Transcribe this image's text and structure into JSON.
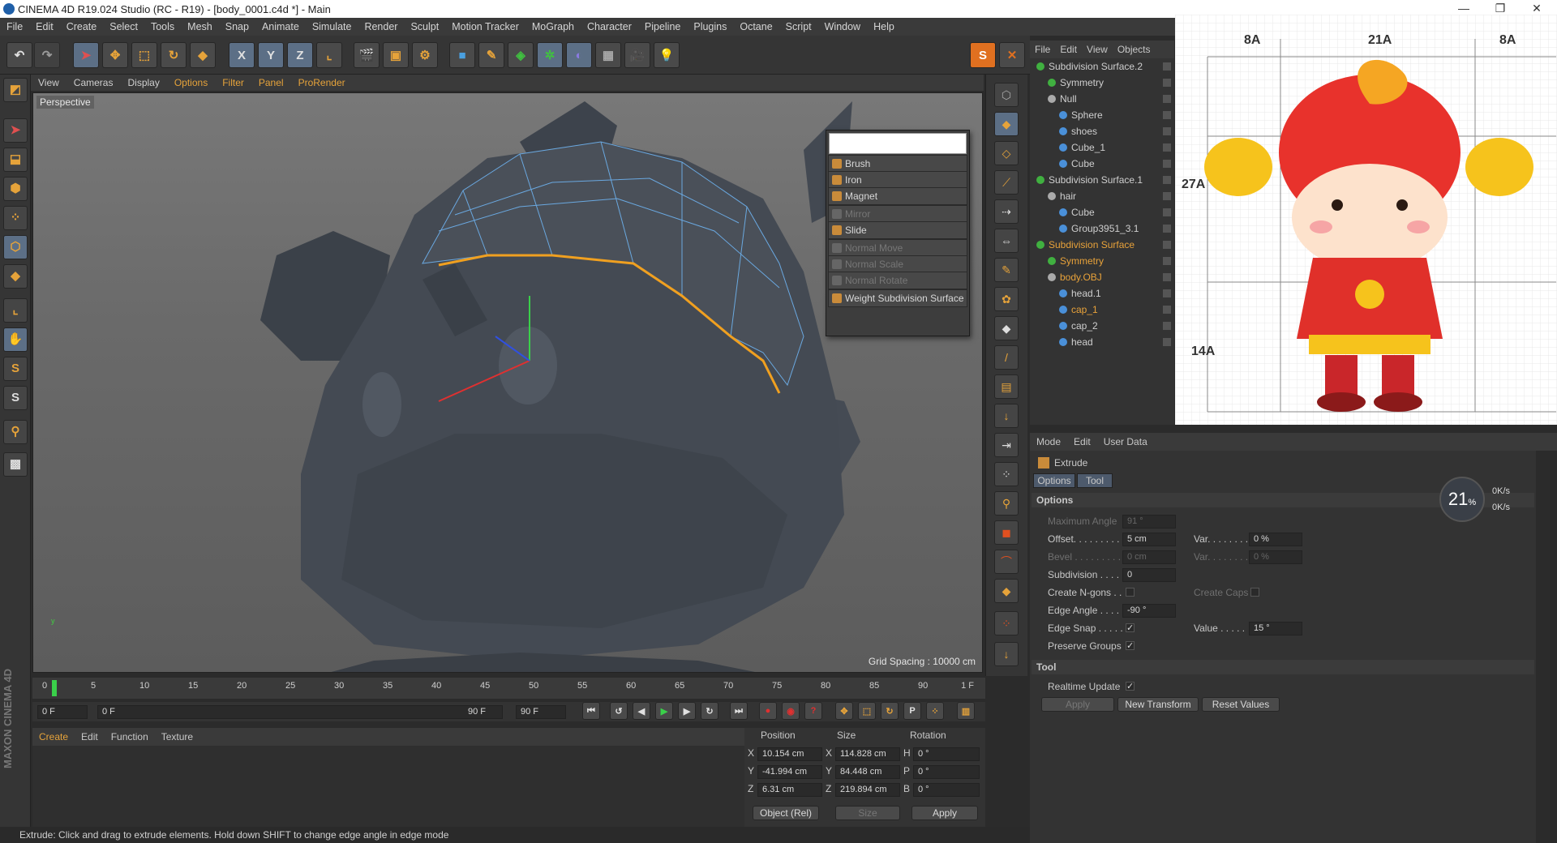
{
  "window": {
    "title": "CINEMA 4D R19.024 Studio (RC - R19) - [body_0001.c4d *] - Main"
  },
  "menu": [
    "File",
    "Edit",
    "Create",
    "Select",
    "Tools",
    "Mesh",
    "Snap",
    "Animate",
    "Simulate",
    "Render",
    "Sculpt",
    "Motion Tracker",
    "MoGraph",
    "Character",
    "Pipeline",
    "Plugins",
    "Octane",
    "Script",
    "Window",
    "Help"
  ],
  "toolbar": {
    "x": "X",
    "y": "Y",
    "z": "Z"
  },
  "viewport": {
    "menu": [
      "View",
      "Cameras",
      "Display",
      "Options",
      "Filter",
      "Panel",
      "ProRender"
    ],
    "label": "Perspective",
    "grid_spacing": "Grid Spacing : 10000 cm"
  },
  "popup": {
    "items": [
      {
        "label": "Brush",
        "enabled": true
      },
      {
        "label": "Iron",
        "enabled": true
      },
      {
        "label": "Magnet",
        "enabled": true
      },
      {
        "label": "Mirror",
        "enabled": false
      },
      {
        "label": "Slide",
        "enabled": true
      },
      {
        "label": "Normal Move",
        "enabled": false
      },
      {
        "label": "Normal Scale",
        "enabled": false
      },
      {
        "label": "Normal Rotate",
        "enabled": false
      },
      {
        "label": "Weight Subdivision Surface",
        "enabled": true
      }
    ]
  },
  "objects": {
    "menu": [
      "File",
      "Edit",
      "View",
      "Objects"
    ],
    "tree": [
      {
        "name": "Subdivision Surface.2",
        "depth": 0,
        "highlight": false,
        "color": "#40b040"
      },
      {
        "name": "Symmetry",
        "depth": 1,
        "highlight": false,
        "color": "#40b040"
      },
      {
        "name": "Null",
        "depth": 1,
        "highlight": false,
        "color": "#aaaaaa"
      },
      {
        "name": "Sphere",
        "depth": 2,
        "highlight": false,
        "color": "#4a90d9"
      },
      {
        "name": "shoes",
        "depth": 2,
        "highlight": false,
        "color": "#4a90d9"
      },
      {
        "name": "Cube_1",
        "depth": 2,
        "highlight": false,
        "color": "#4a90d9"
      },
      {
        "name": "Cube",
        "depth": 2,
        "highlight": false,
        "color": "#4a90d9"
      },
      {
        "name": "Subdivision Surface.1",
        "depth": 0,
        "highlight": false,
        "color": "#40b040"
      },
      {
        "name": "hair",
        "depth": 1,
        "highlight": false,
        "color": "#aaaaaa"
      },
      {
        "name": "Cube",
        "depth": 2,
        "highlight": false,
        "color": "#4a90d9"
      },
      {
        "name": "Group3951_3.1",
        "depth": 2,
        "highlight": false,
        "color": "#4a90d9"
      },
      {
        "name": "Subdivision Surface",
        "depth": 0,
        "highlight": true,
        "color": "#40b040"
      },
      {
        "name": "Symmetry",
        "depth": 1,
        "highlight": true,
        "color": "#40b040"
      },
      {
        "name": "body.OBJ",
        "depth": 1,
        "highlight": true,
        "color": "#aaaaaa"
      },
      {
        "name": "head.1",
        "depth": 2,
        "highlight": false,
        "color": "#4a90d9"
      },
      {
        "name": "cap_1",
        "depth": 2,
        "highlight": true,
        "color": "#4a90d9"
      },
      {
        "name": "cap_2",
        "depth": 2,
        "highlight": false,
        "color": "#4a90d9"
      },
      {
        "name": "head",
        "depth": 2,
        "highlight": false,
        "color": "#4a90d9"
      }
    ]
  },
  "reference": {
    "labels": [
      "8A",
      "21A",
      "8A",
      "27A",
      "14A"
    ]
  },
  "attributes": {
    "menu": [
      "Mode",
      "Edit",
      "User Data"
    ],
    "tool_name": "Extrude",
    "tabs": [
      "Options",
      "Tool"
    ],
    "section_options": "Options",
    "section_tool": "Tool",
    "fields": {
      "max_angle_label": "Maximum Angle",
      "max_angle": "91 °",
      "offset_label": "Offset. . . . . . . . .",
      "offset": "5 cm",
      "var1_label": "Var. . . . . . . .",
      "var1": "0 %",
      "bevel_label": "Bevel . . . . . . . . .",
      "bevel": "0 cm",
      "var2_label": "Var. . . . . . . .",
      "var2": "0 %",
      "subdivision_label": "Subdivision . . . .",
      "subdivision": "0",
      "create_ngons_label": "Create N-gons . .",
      "create_caps_label": "Create Caps",
      "edge_angle_label": "Edge Angle . . . .",
      "edge_angle": "-90 °",
      "edge_snap_label": "Edge Snap . . . . .",
      "value_label": "Value . . . . .",
      "value": "15 °",
      "preserve_groups_label": "Preserve Groups",
      "realtime_update_label": "Realtime Update"
    },
    "buttons": {
      "apply": "Apply",
      "new_transform": "New Transform",
      "reset_values": "Reset Values"
    }
  },
  "perf": {
    "value": "21",
    "unit": "%",
    "up": "0K/s",
    "down": "0K/s"
  },
  "timeline": {
    "ticks": [
      "0",
      "5",
      "10",
      "15",
      "20",
      "25",
      "30",
      "35",
      "40",
      "45",
      "50",
      "55",
      "60",
      "65",
      "70",
      "75",
      "80",
      "85",
      "90"
    ],
    "end_frame": "1 F",
    "current": "0 F",
    "range_start": "0 F",
    "range_end": "90 F",
    "max": "90 F"
  },
  "materials": {
    "menu": [
      "Create",
      "Edit",
      "Function",
      "Texture"
    ]
  },
  "coords": {
    "headers": [
      "Position",
      "Size",
      "Rotation"
    ],
    "rows": [
      {
        "axis": "X",
        "pos": "10.154 cm",
        "saxis": "X",
        "size": "114.828 cm",
        "raxis": "H",
        "rot": "0 °"
      },
      {
        "axis": "Y",
        "pos": "-41.994 cm",
        "saxis": "Y",
        "size": "84.448 cm",
        "raxis": "P",
        "rot": "0 °"
      },
      {
        "axis": "Z",
        "pos": "6.31 cm",
        "saxis": "Z",
        "size": "219.894 cm",
        "raxis": "B",
        "rot": "0 °"
      }
    ],
    "mode": "Object (Rel)",
    "size_mode": "Size",
    "apply": "Apply"
  },
  "status": "Extrude: Click and drag to extrude elements. Hold down SHIFT to change edge angle in edge mode",
  "brand": "MAXON CINEMA 4D"
}
